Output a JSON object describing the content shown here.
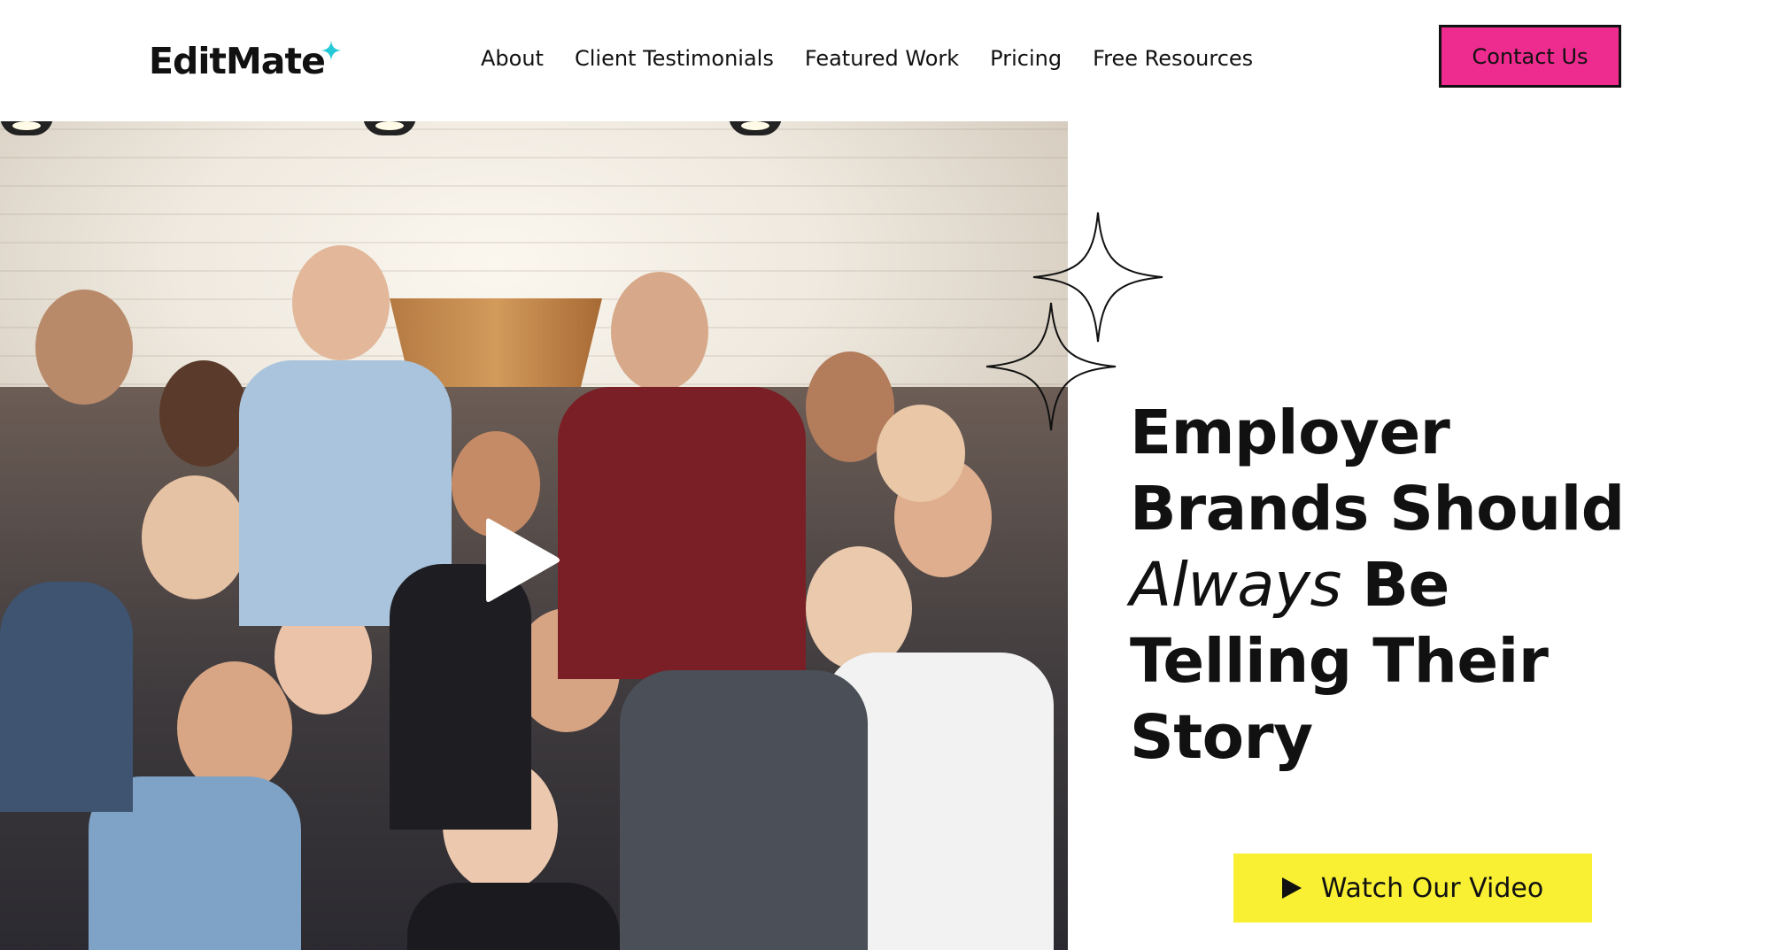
{
  "brand": {
    "logo_text": "EditMate",
    "accent_color": "#25c9d6"
  },
  "nav": {
    "items": [
      {
        "label": "About"
      },
      {
        "label": "Client Testimonials"
      },
      {
        "label": "Featured Work"
      },
      {
        "label": "Pricing"
      },
      {
        "label": "Free Resources"
      }
    ],
    "cta_label": "Contact Us",
    "cta_color": "#ee2b8e"
  },
  "hero": {
    "headline_line1": "Employer",
    "headline_line2": "Brands Should",
    "headline_italic": "Always",
    "headline_line3_rest": " Be",
    "headline_line4": "Telling Their",
    "headline_line5": "Story",
    "video_button_label": "Watch Our Video",
    "video_button_color": "#f9f034",
    "media_icon": "play-icon"
  }
}
